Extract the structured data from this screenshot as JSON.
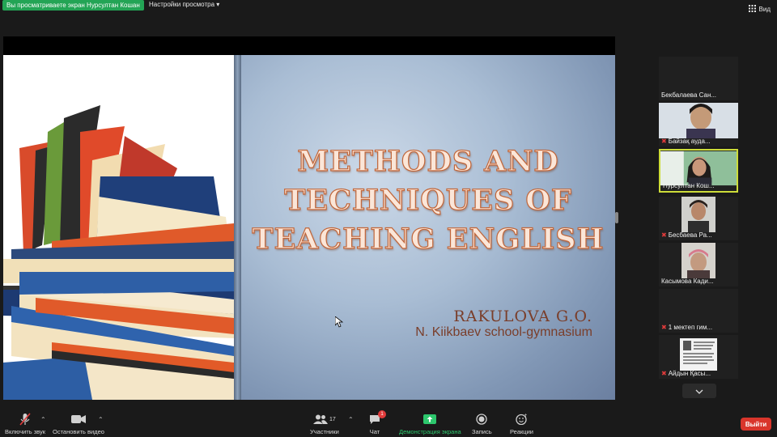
{
  "topbar": {
    "viewing_text": "Вы просматриваете экран Нурсултан Кошан",
    "view_options": "Настройки просмотра",
    "view_button": "Вид"
  },
  "slide": {
    "title_line1": "METHODS AND",
    "title_line2": "TECHNIQUES OF",
    "title_line3": "TEACHING ENGLISH",
    "author": "RAKULOVA G.O.",
    "school": "N. Kiikbaev school-gymnasium"
  },
  "gallery": {
    "tiles": [
      {
        "name": "Бекбалаева Сан...",
        "muted": false,
        "has_video": false
      },
      {
        "name": "Байзақ ауда...",
        "muted": true,
        "has_video": true
      },
      {
        "name": "Нурсултан Кош...",
        "muted": false,
        "has_video": true,
        "active": true
      },
      {
        "name": "Бесбаева Ра...",
        "muted": true,
        "has_video": true
      },
      {
        "name": "Касымова Кади...",
        "muted": false,
        "has_video": true
      },
      {
        "name": "1 мектеп гим...",
        "muted": true,
        "has_video": false
      },
      {
        "name": "Айдын Қасы...",
        "muted": true,
        "has_video": true
      }
    ]
  },
  "toolbar": {
    "unmute_label": "Включить звук",
    "stop_video_label": "Остановить видео",
    "participants_label": "Участники",
    "participants_count": "17",
    "chat_label": "Чат",
    "chat_badge": "1",
    "share_label": "Демонстрация экрана",
    "record_label": "Запись",
    "reactions_label": "Реакции",
    "exit_label": "Выйти"
  },
  "colors": {
    "share_green": "#2dc76d",
    "exit_red": "#d9352b",
    "active_border": "#cddc39",
    "title_orange": "#c1663a"
  }
}
